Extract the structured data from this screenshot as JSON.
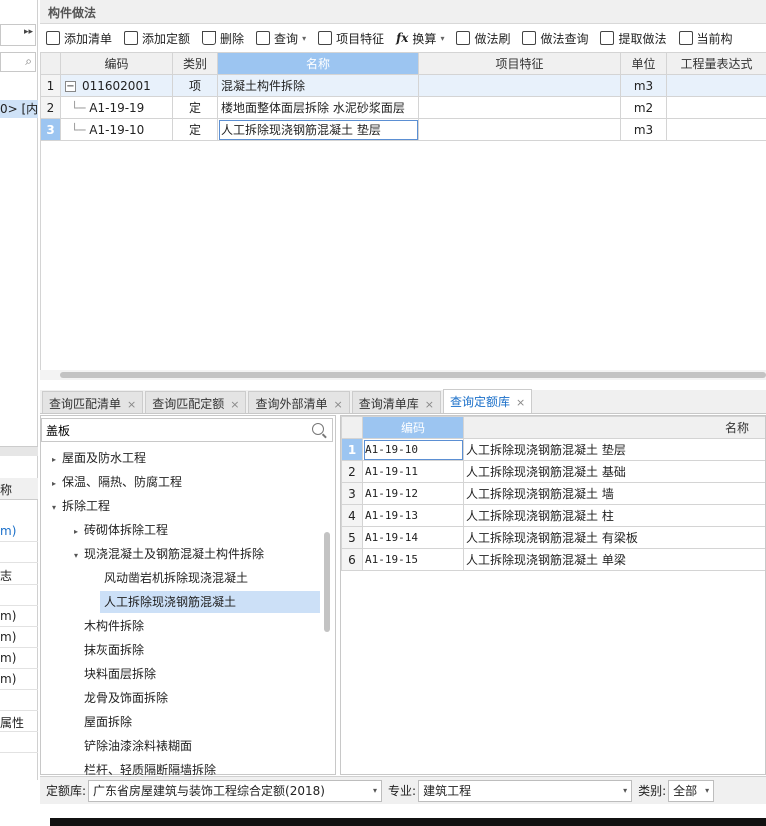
{
  "left_panel": {
    "expand_glyph": "▸▸",
    "search_glyph": "⌕",
    "code_fragment": "0> [内",
    "col_header_fragment": "称",
    "rows": [
      "m)",
      "",
      "志",
      "",
      "m)",
      "m)",
      "m)",
      "m)",
      "",
      "属性"
    ]
  },
  "top": {
    "title": "构件做法",
    "toolbar": [
      {
        "label": "添加清单",
        "icon": "add-list-icon"
      },
      {
        "label": "添加定额",
        "icon": "add-quota-icon"
      },
      {
        "label": "删除",
        "icon": "trash-icon"
      },
      {
        "label": "查询",
        "icon": "query-icon",
        "dropdown": true
      },
      {
        "label": "项目特征",
        "icon": "feature-icon"
      },
      {
        "label": "换算",
        "icon": "fx-icon",
        "dropdown": true
      },
      {
        "label": "做法刷",
        "icon": "brush-icon"
      },
      {
        "label": "做法查询",
        "icon": "method-query-icon"
      },
      {
        "label": "提取做法",
        "icon": "extract-icon"
      },
      {
        "label": "当前构",
        "icon": "current-icon"
      }
    ],
    "grid": {
      "headers": [
        "编码",
        "类别",
        "名称",
        "项目特征",
        "单位",
        "工程量表达式"
      ],
      "rows": [
        {
          "num": "1",
          "code": "011602001",
          "type": "项",
          "name": "混凝土构件拆除",
          "feature": "",
          "unit": "m3",
          "expr": ""
        },
        {
          "num": "2",
          "code": "A1-19-19",
          "type": "定",
          "name": "楼地面整体面层拆除 水泥砂浆面层",
          "feature": "",
          "unit": "m2",
          "expr": ""
        },
        {
          "num": "3",
          "code": "A1-19-10",
          "type": "定",
          "name": "人工拆除现浇钢筋混凝土 垫层",
          "feature": "",
          "unit": "m3",
          "expr": ""
        }
      ]
    }
  },
  "tabs": [
    {
      "label": "查询匹配清单",
      "active": false
    },
    {
      "label": "查询匹配定额",
      "active": false
    },
    {
      "label": "查询外部清单",
      "active": false
    },
    {
      "label": "查询清单库",
      "active": false
    },
    {
      "label": "查询定额库",
      "active": true
    }
  ],
  "tree": {
    "search_value": "盖板",
    "items": [
      {
        "label": "屋面及防水工程",
        "arrow": "▸",
        "level": 0
      },
      {
        "label": "保温、隔热、防腐工程",
        "arrow": "▸",
        "level": 0
      },
      {
        "label": "拆除工程",
        "arrow": "▾",
        "level": 0
      },
      {
        "label": "砖砌体拆除工程",
        "arrow": "▸",
        "level": 1
      },
      {
        "label": "现浇混凝土及钢筋混凝土构件拆除",
        "arrow": "▾",
        "level": 1
      },
      {
        "label": "风动凿岩机拆除现浇混凝土",
        "arrow": "",
        "level": 2
      },
      {
        "label": "人工拆除现浇钢筋混凝土",
        "arrow": "",
        "level": 2,
        "selected": true
      },
      {
        "label": "木构件拆除",
        "arrow": "",
        "level": 1
      },
      {
        "label": "抹灰面拆除",
        "arrow": "",
        "level": 1
      },
      {
        "label": "块料面层拆除",
        "arrow": "",
        "level": 1
      },
      {
        "label": "龙骨及饰面拆除",
        "arrow": "",
        "level": 1
      },
      {
        "label": "屋面拆除",
        "arrow": "",
        "level": 1
      },
      {
        "label": "铲除油漆涂料裱糊面",
        "arrow": "",
        "level": 1
      },
      {
        "label": "栏杆、轻质隔断隔墙拆除",
        "arrow": "",
        "level": 1
      }
    ]
  },
  "quota_table": {
    "headers": [
      "编码",
      "名称"
    ],
    "rows": [
      {
        "num": "1",
        "code": "A1-19-10",
        "name": "人工拆除现浇钢筋混凝土 垫层"
      },
      {
        "num": "2",
        "code": "A1-19-11",
        "name": "人工拆除现浇钢筋混凝土 基础"
      },
      {
        "num": "3",
        "code": "A1-19-12",
        "name": "人工拆除现浇钢筋混凝土 墙"
      },
      {
        "num": "4",
        "code": "A1-19-13",
        "name": "人工拆除现浇钢筋混凝土 柱"
      },
      {
        "num": "5",
        "code": "A1-19-14",
        "name": "人工拆除现浇钢筋混凝土 有梁板"
      },
      {
        "num": "6",
        "code": "A1-19-15",
        "name": "人工拆除现浇钢筋混凝土 单梁"
      }
    ]
  },
  "filter": {
    "lib_label": "定额库:",
    "lib_value": "广东省房屋建筑与装饰工程综合定额(2018)",
    "major_label": "专业:",
    "major_value": "建筑工程",
    "category_label": "类别:",
    "category_value": "全部"
  },
  "colors": {
    "accent": "#9cc5f1",
    "tab_active_text": "#1a6fc9",
    "selection": "#cce0f7"
  }
}
